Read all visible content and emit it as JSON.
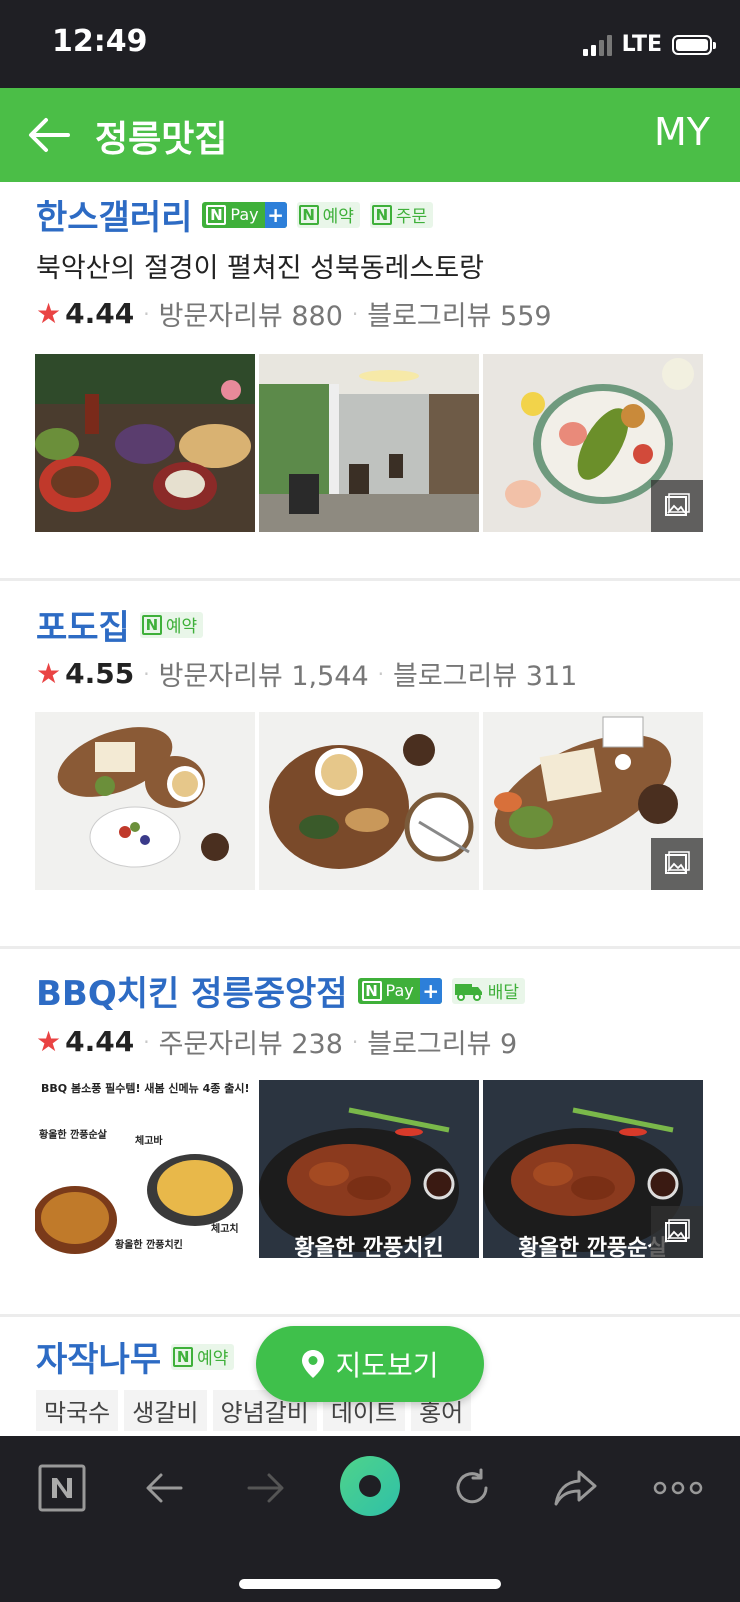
{
  "status_bar": {
    "time": "12:49",
    "network": "LTE"
  },
  "header": {
    "title": "정릉맛집",
    "my_label": "MY"
  },
  "badges": {
    "npay": "Pay",
    "reserve": "예약",
    "order": "주문",
    "delivery": "배달",
    "n": "N"
  },
  "places": [
    {
      "name": "한스갤러리",
      "description": "북악산의 절경이 펼쳐진 성북동레스토랑",
      "rating": "4.44",
      "review1": "방문자리뷰 880",
      "review2": "블로그리뷰 559"
    },
    {
      "name": "포도집",
      "rating": "4.55",
      "review1": "방문자리뷰 1,544",
      "review2": "블로그리뷰 311"
    },
    {
      "name": "BBQ치킨 정릉중앙점",
      "rating": "4.44",
      "review1": "주문자리뷰 238",
      "review2": "블로그리뷰 9",
      "photo_texts": {
        "promo_top": "BBQ 봄소풍 필수템! 새봄 신메뉴 4종 출시!",
        "promo_item1": "황올한 깐풍순살",
        "promo_item2": "체고바",
        "promo_item3": "체고치",
        "promo_item4": "황올한 깐풍치킨",
        "photo2_caption": "황올한 깐풍치킨",
        "photo3_caption": "황올한 깐풍순살"
      }
    },
    {
      "name": "자작나무",
      "tags": [
        "막국수",
        "생갈비",
        "양념갈비",
        "데이트",
        "홍어"
      ]
    }
  ],
  "map_button": {
    "label": "지도보기"
  },
  "colors": {
    "brand_green": "#4bbe47",
    "link_blue": "#2d6bc4",
    "star_red": "#e94343"
  }
}
